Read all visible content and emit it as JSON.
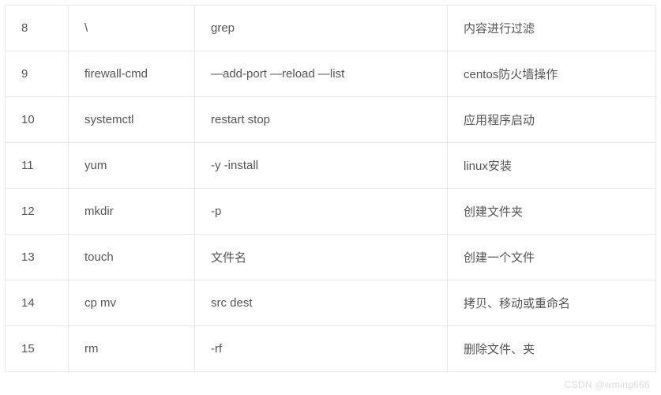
{
  "table": {
    "rows": [
      {
        "num": "8",
        "cmd": "\\",
        "opts": "grep",
        "desc": "内容进行过滤"
      },
      {
        "num": "9",
        "cmd": "firewall-cmd",
        "opts": "—add-port —reload —list",
        "desc": "centos防火墙操作"
      },
      {
        "num": "10",
        "cmd": "systemctl",
        "opts": "restart stop",
        "desc": "应用程序启动"
      },
      {
        "num": "11",
        "cmd": "yum",
        "opts": "-y -install",
        "desc": "linux安装"
      },
      {
        "num": "12",
        "cmd": "mkdir",
        "opts": "-p",
        "desc": "创建文件夹"
      },
      {
        "num": "13",
        "cmd": "touch",
        "opts": "文件名",
        "desc": "创建一个文件"
      },
      {
        "num": "14",
        "cmd": "cp mv",
        "opts": "src dest",
        "desc": "拷贝、移动或重命名"
      },
      {
        "num": "15",
        "cmd": "rm",
        "opts": "-rf",
        "desc": "删除文件、夹"
      }
    ]
  },
  "watermark": "CSDN @wming666"
}
